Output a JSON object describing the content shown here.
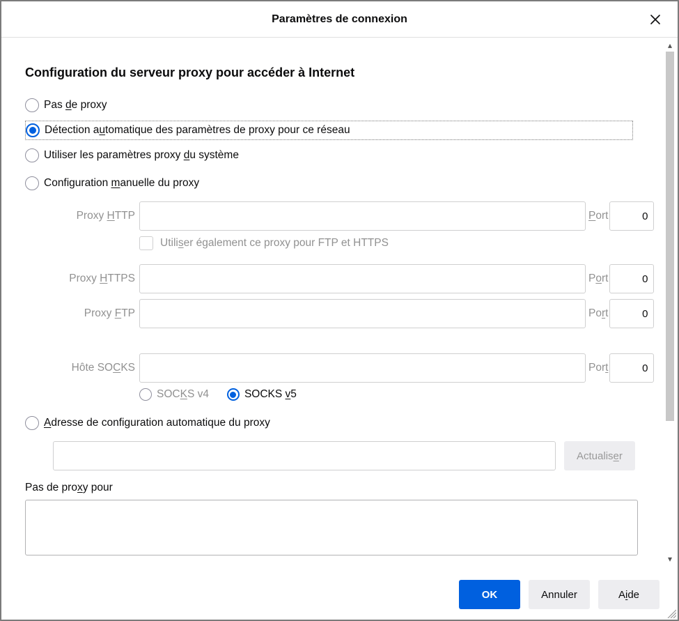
{
  "title": "Paramètres de connexion",
  "section_title": "Configuration du serveur proxy pour accéder à Internet",
  "radios": {
    "none_pre": "Pas ",
    "none_u": "d",
    "none_post": "e proxy",
    "auto_pre": "Détection a",
    "auto_u": "u",
    "auto_post": "tomatique des paramètres de proxy pour ce réseau",
    "system_pre": "Utiliser les paramètres proxy ",
    "system_u": "d",
    "system_post": "u système",
    "manual_pre": "Configuration ",
    "manual_u": "m",
    "manual_post": "anuelle du proxy",
    "pac_u": "A",
    "pac_post": "dresse de configuration automatique du proxy"
  },
  "form": {
    "http_label_pre": "Proxy ",
    "http_label_u": "H",
    "http_label_post": "TTP",
    "http_value": "",
    "http_port_label_u": "P",
    "http_port_label_post": "ort",
    "http_port": "0",
    "samecheck_pre": "Utili",
    "samecheck_u": "s",
    "samecheck_post": "er également ce proxy pour FTP et HTTPS",
    "https_label_pre": "Proxy ",
    "https_label_u": "H",
    "https_label_post": "TTPS",
    "https_value": "",
    "https_port_label_pre": "P",
    "https_port_label_u": "o",
    "https_port_label_post": "rt",
    "https_port": "0",
    "ftp_label_pre": "Proxy ",
    "ftp_label_u": "F",
    "ftp_label_post": "TP",
    "ftp_value": "",
    "ftp_port_label_pre": "Po",
    "ftp_port_label_u": "r",
    "ftp_port_label_post": "t",
    "ftp_port": "0",
    "socks_label_pre": "Hôte SO",
    "socks_label_u": "C",
    "socks_label_post": "KS",
    "socks_value": "",
    "socks_port_label_pre": "Por",
    "socks_port_label_u": "t",
    "socks_port": "0",
    "socks4_pre": "SOC",
    "socks4_u": "K",
    "socks4_post": "S v4",
    "socks5_pre": "SOCKS ",
    "socks5_u": "v",
    "socks5_post": "5"
  },
  "pac": {
    "value": "",
    "reload_pre": "Actualis",
    "reload_u": "e",
    "reload_post": "r"
  },
  "noproxy": {
    "label_pre": "Pas de pro",
    "label_u": "x",
    "label_post": "y pour",
    "value": ""
  },
  "footer": {
    "ok": "OK",
    "cancel": "Annuler",
    "help_pre": "A",
    "help_u": "i",
    "help_post": "de"
  }
}
